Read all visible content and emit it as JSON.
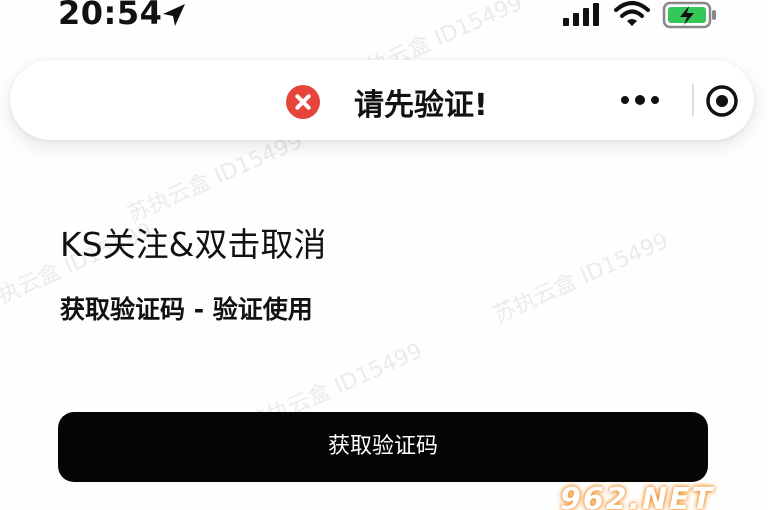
{
  "status_bar": {
    "time": "20:54"
  },
  "toast": {
    "text": "请先验证!",
    "icon": "error-circle-icon"
  },
  "capsule": {
    "more_icon": "more-dots-icon",
    "close_icon": "close-miniprogram-icon"
  },
  "content": {
    "title": "KS关注&双击取消",
    "subtitle": "获取验证码 - 验证使用",
    "button_label": "获取验证码"
  },
  "watermarks": {
    "text": "苏执云盒 ID15499",
    "logo": "962.NET"
  },
  "colors": {
    "error": "#e5453b",
    "button_bg": "#050505",
    "battery_charge": "#34c759",
    "logo_glow": "#f08a1c"
  }
}
